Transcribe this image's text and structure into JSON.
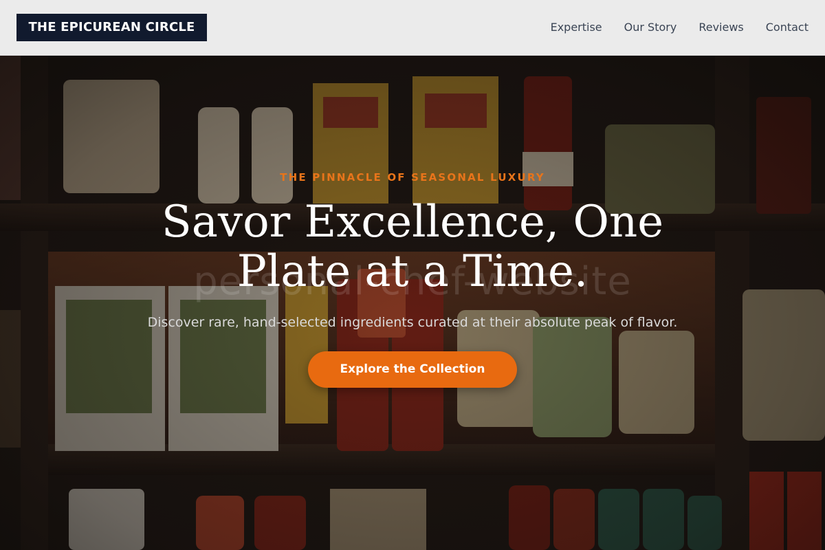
{
  "header": {
    "logo_text": "THE EPICUREAN CIRCLE",
    "nav": [
      {
        "label": "Expertise"
      },
      {
        "label": "Our Story"
      },
      {
        "label": "Reviews"
      },
      {
        "label": "Contact"
      }
    ]
  },
  "hero": {
    "eyebrow": "THE PINNACLE OF SEASONAL LUXURY",
    "title": "Savor Excellence, One Plate at a Time.",
    "subtitle": "Discover rare, hand-selected ingredients curated at their absolute peak of flavor.",
    "watermark": "personal-chef-website",
    "cta_label": "Explore the Collection"
  },
  "colors": {
    "accent": "#e8741a",
    "button": "#e86a10",
    "logo_bg": "#111a2e",
    "header_bg": "#ebebeb"
  }
}
